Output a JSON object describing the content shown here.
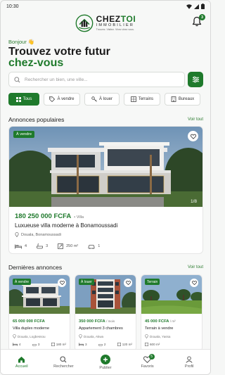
{
  "status_bar": {
    "time": "10:30"
  },
  "header": {
    "brand_part1": "CHEZ",
    "brand_part2": "TOI",
    "brand_sub": "IMMOBILIER",
    "brand_tagline": "Trouvez. Visitez. Vivez chez vous.",
    "notifications_count": "3"
  },
  "greeting": "Bonjour 👋",
  "title_line1": "Trouvez votre futur",
  "title_line2": "chez-vous",
  "search": {
    "placeholder": "Rechercher un bien, une ville..."
  },
  "categories": [
    {
      "label": "Tous",
      "icon": "grid-icon",
      "active": true
    },
    {
      "label": "À vendre",
      "icon": "tag-icon",
      "active": false
    },
    {
      "label": "À louer",
      "icon": "key-icon",
      "active": false
    },
    {
      "label": "Terrains",
      "icon": "land-icon",
      "active": false
    },
    {
      "label": "Bureaux",
      "icon": "office-icon",
      "active": false
    }
  ],
  "popular": {
    "title": "Annonces populaires",
    "see_all": "Voir tout",
    "listing": {
      "badge": "À vendre",
      "image_counter": "1/8",
      "price": "180 250 000 FCFA",
      "type": "• Villa",
      "title": "Luxueuse villa moderne à Bonamoussadi",
      "location": "Douala, Bonamoussadi",
      "bedrooms": "4",
      "bathrooms": "3",
      "area": "250 m²",
      "parking": "1"
    }
  },
  "recent": {
    "title": "Dernières annonces",
    "see_all": "Voir tout",
    "listings": [
      {
        "badge": "À vendre",
        "price": "65 000 000 FCFA",
        "per": "",
        "title": "Villa duplex moderne",
        "location": "Douala, Logbessou",
        "beds": "4",
        "baths": "3",
        "area": "180 m²"
      },
      {
        "badge": "À louer",
        "price": "350 000 FCFA",
        "per": "/ mois",
        "title": "Appartement 3 chambres",
        "location": "Douala, Akwa",
        "beds": "3",
        "baths": "2",
        "area": "120 m²"
      },
      {
        "badge": "Terrain",
        "price": "45 000 FCFA",
        "per": "/ m²",
        "title": "Terrain à vendre",
        "location": "Douala, Yassa",
        "beds": "",
        "baths": "",
        "area": "600 m²"
      }
    ]
  },
  "bottom_nav": [
    {
      "label": "Accueil",
      "icon": "home-icon",
      "active": true
    },
    {
      "label": "Rechercher",
      "icon": "search-icon",
      "active": false
    },
    {
      "label": "Publier",
      "icon": "plus-icon",
      "active": false
    },
    {
      "label": "Favoris",
      "icon": "heart-icon",
      "active": false,
      "badge": "5"
    },
    {
      "label": "Profil",
      "icon": "user-icon",
      "active": false
    }
  ],
  "colors": {
    "accent": "#1f7a2c"
  }
}
